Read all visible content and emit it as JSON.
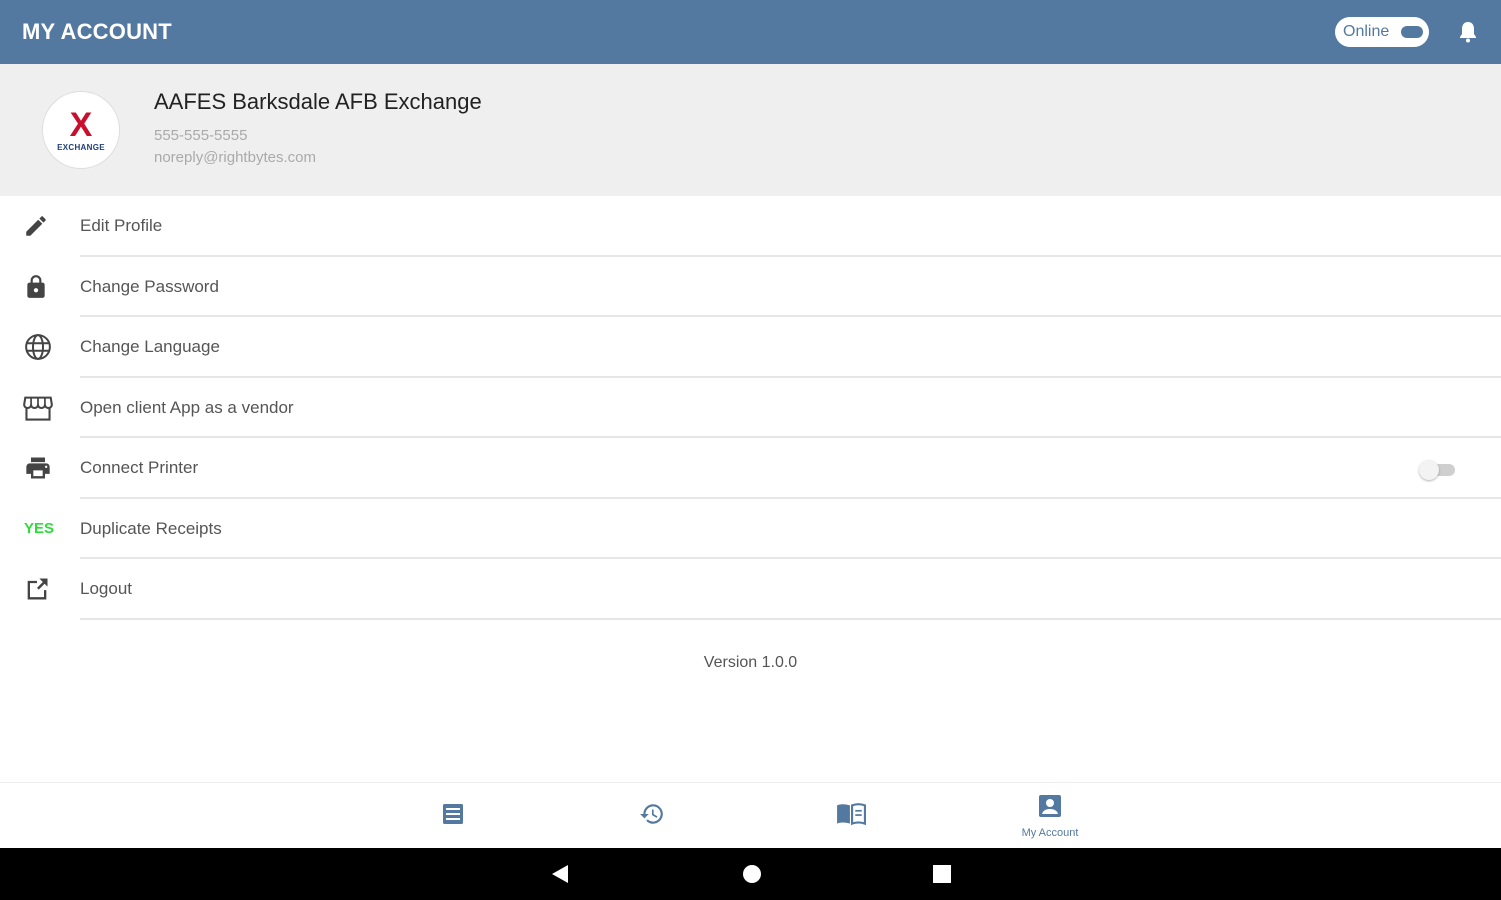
{
  "header": {
    "title": "MY ACCOUNT",
    "status_label": "Online",
    "accent_color": "#5479a0"
  },
  "profile": {
    "logo_letter": "X",
    "logo_word": "EXCHANGE",
    "name": "AAFES Barksdale AFB Exchange",
    "phone": "555-555-5555",
    "email": "noreply@rightbytes.com"
  },
  "menu": {
    "items": [
      {
        "label": "Edit Profile",
        "icon": "pencil-icon"
      },
      {
        "label": "Change Password",
        "icon": "lock-icon"
      },
      {
        "label": "Change Language",
        "icon": "globe-icon"
      },
      {
        "label": "Open client App as a vendor",
        "icon": "store-icon"
      },
      {
        "label": "Connect Printer",
        "icon": "printer-icon",
        "toggle_on": false
      },
      {
        "label": "Duplicate Receipts",
        "icon_text": "YES",
        "icon_color": "#2dde3a"
      },
      {
        "label": "Logout",
        "icon": "logout-icon"
      }
    ]
  },
  "version": "Version 1.0.0",
  "bottom_nav": {
    "items": [
      {
        "icon": "list-icon",
        "label": ""
      },
      {
        "icon": "history-icon",
        "label": ""
      },
      {
        "icon": "catalog-icon",
        "label": ""
      },
      {
        "icon": "account-icon",
        "label": "My Account",
        "active": true
      }
    ]
  },
  "system_nav": [
    "back-icon",
    "home-icon",
    "recents-icon"
  ]
}
